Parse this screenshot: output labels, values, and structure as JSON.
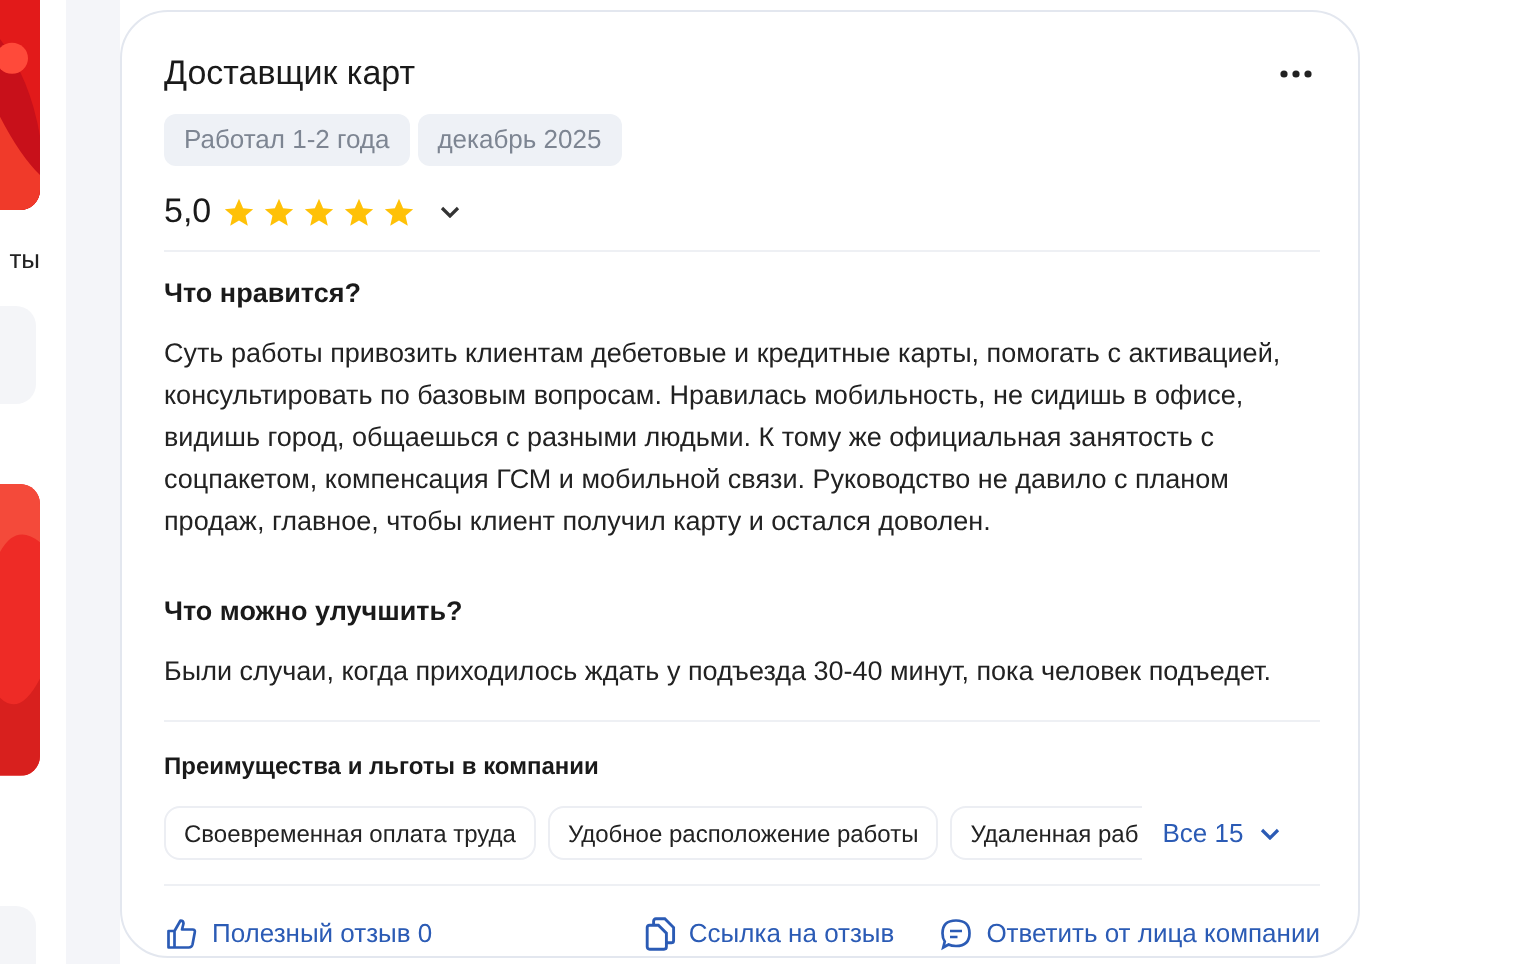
{
  "side": {
    "caption": "ты"
  },
  "review": {
    "title": "Доставщик карт",
    "tags": [
      "Работал 1-2 года",
      "декабрь 2025"
    ],
    "rating": "5,0",
    "stars": 5,
    "sections": [
      {
        "heading": "Что нравится?",
        "text": "Суть работы привозить клиентам дебетовые и кредитные карты, помогать с активацией, консультировать по базовым вопросам. Нравилась мобильность, не сидишь в офисе, видишь город, общаешься с разными людьми. К тому же официальная занятость с соцпакетом, компенсация ГСМ и мобильной связи. Руководство не давило с планом продаж, главное, чтобы клиент получил карту и остался доволен."
      },
      {
        "heading": "Что можно улучшить?",
        "text": "Были случаи, когда приходилось ждать у подъезда 30-40 минут, пока человек подъедет."
      }
    ],
    "benefits": {
      "heading": "Преимущества и льготы в компании",
      "items": [
        "Своевременная оплата труда",
        "Удобное расположение работы",
        "Удаленная раб"
      ],
      "more": "Все 15"
    },
    "actions": [
      {
        "kind": "like",
        "label": "Полезный отзыв 0"
      },
      {
        "kind": "link",
        "label": "Ссылка на отзыв"
      },
      {
        "kind": "reply",
        "label": "Ответить от лица компании"
      }
    ]
  }
}
